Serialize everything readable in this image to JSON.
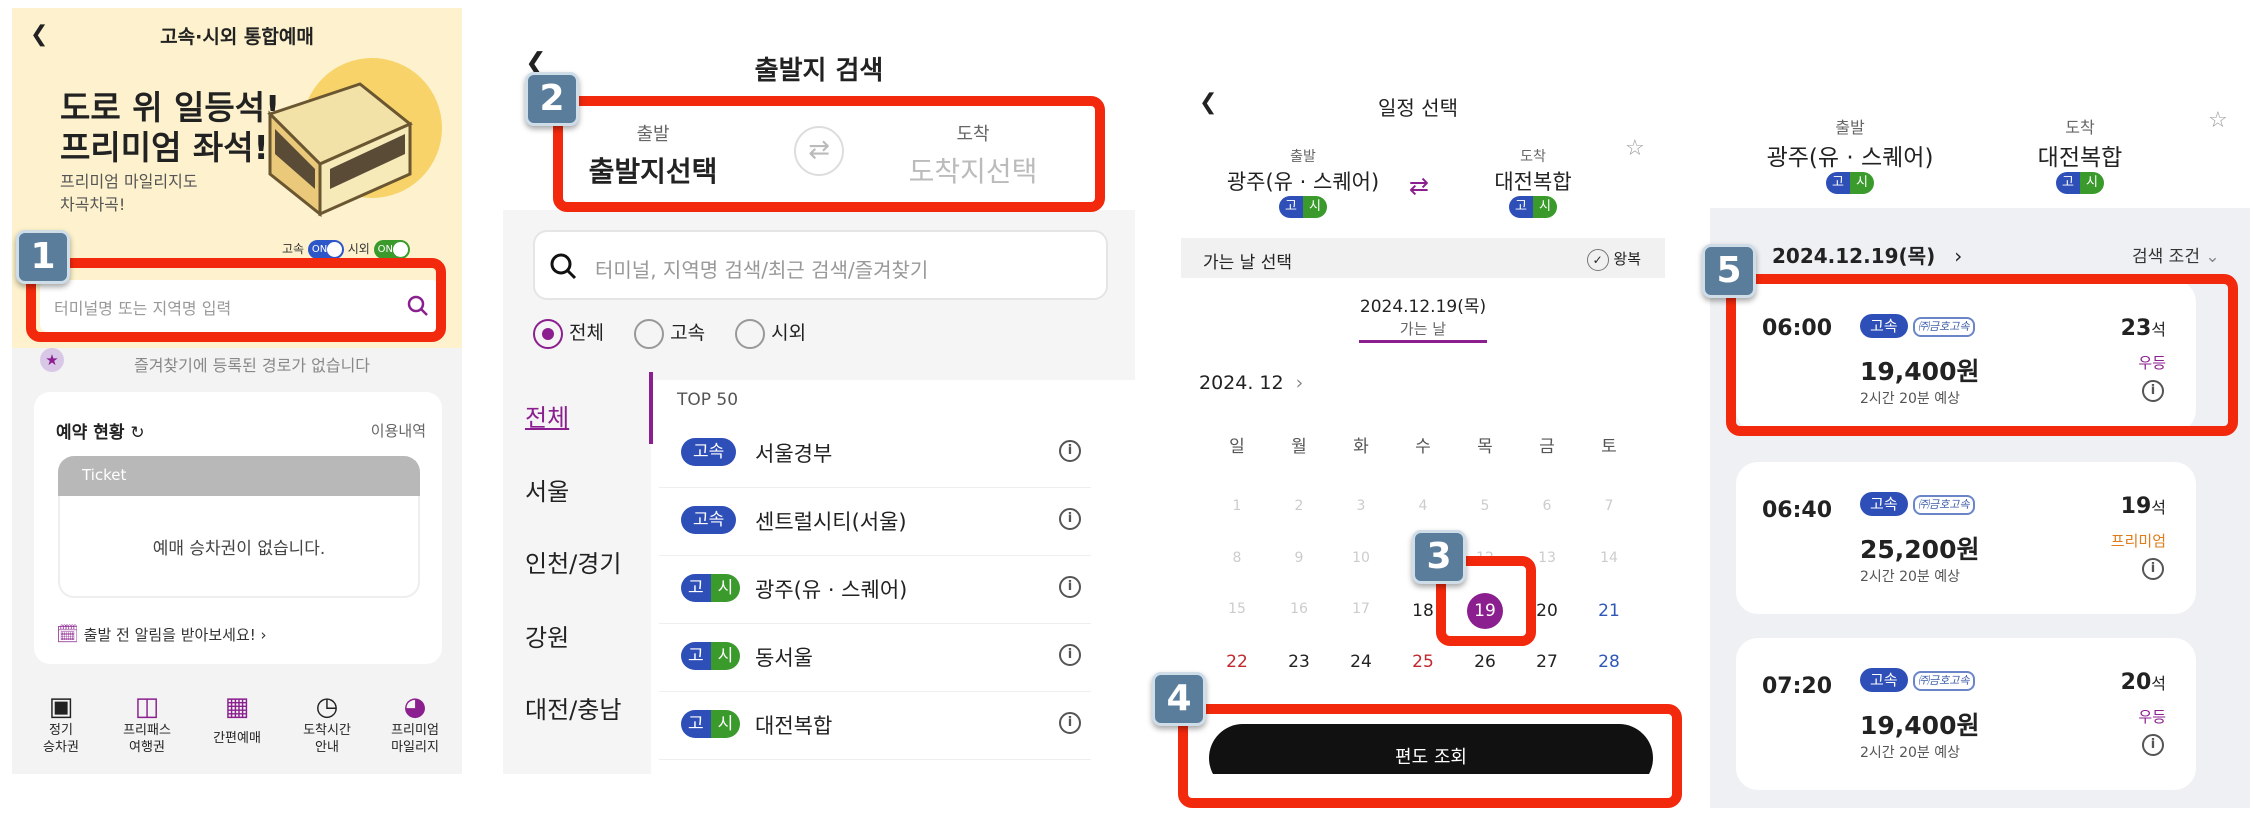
{
  "panel1": {
    "title": "고속·시외 통합예매",
    "banner_line1": "도로 위 일등석!",
    "banner_line2": "프리미엄 좌석!",
    "banner_sub1": "프리미엄 마일리지도",
    "banner_sub2": "차곡차곡!",
    "toggle_express": "고속",
    "toggle_intercity": "시외",
    "toggle_on": "ON",
    "search_placeholder": "터미널명 또는 지역명 입력",
    "favorites_empty": "즐겨찾기에 등록된 경로가 없습니다",
    "reservation_title": "예약 현황",
    "history_link": "이용내역",
    "ticket_label": "Ticket",
    "no_ticket": "예매 승차권이 없습니다.",
    "alert_link": "출발 전 알림을 받아보세요!",
    "bottom_menu": [
      {
        "l1": "정기",
        "l2": "승차권"
      },
      {
        "l1": "프리패스",
        "l2": "여행권"
      },
      {
        "l1": "간편예매",
        "l2": ""
      },
      {
        "l1": "도착시간",
        "l2": "안내"
      },
      {
        "l1": "프리미엄",
        "l2": "마일리지"
      }
    ]
  },
  "panel2": {
    "title": "출발지 검색",
    "depart_label": "출발",
    "depart_value": "출발지선택",
    "arrive_label": "도착",
    "arrive_value": "도착지선택",
    "search_placeholder": "터미널, 지역명 검색/최근 검색/즐겨찾기",
    "filters": [
      "전체",
      "고속",
      "시외"
    ],
    "regions": [
      "전체",
      "서울",
      "인천/경기",
      "강원",
      "대전/충남"
    ],
    "top_label": "TOP 50",
    "terminals": [
      {
        "type": "고속",
        "name": "서울경부"
      },
      {
        "type": "고속",
        "name": "센트럴시티(서울)"
      },
      {
        "type": "고시",
        "name": "광주(유 · 스퀘어)"
      },
      {
        "type": "고시",
        "name": "동서울"
      },
      {
        "type": "고시",
        "name": "대전복합"
      }
    ],
    "badge_express": "고속",
    "badge_g": "고",
    "badge_s": "시"
  },
  "panel3": {
    "title": "일정 선택",
    "depart_label": "출발",
    "depart_value": "광주(유 · 스퀘어)",
    "arrive_label": "도착",
    "arrive_value": "대전복합",
    "badge_g": "고",
    "badge_s": "시",
    "go_day": "가는 날 선택",
    "round_trip": "왕복",
    "date_sel": "2024.12.19(목)",
    "date_tab": "가는 날",
    "month": "2024. 12",
    "weekdays": [
      "일",
      "월",
      "화",
      "수",
      "목",
      "금",
      "토"
    ],
    "rows": [
      [
        "1",
        "2",
        "3",
        "4",
        "5",
        "6",
        "7"
      ],
      [
        "8",
        "9",
        "10",
        "11",
        "12",
        "13",
        "14"
      ],
      [
        "15",
        "16",
        "17",
        "18",
        "19",
        "20",
        "21"
      ],
      [
        "22",
        "23",
        "24",
        "25",
        "26",
        "27",
        "28"
      ]
    ],
    "search_button": "편도 조회"
  },
  "panel4": {
    "depart_label": "출발",
    "depart_value": "광주(유 · 스퀘어)",
    "arrive_label": "도착",
    "arrive_value": "대전복합",
    "badge_g": "고",
    "badge_s": "시",
    "date": "2024.12.19(목)",
    "filter": "검색 조건",
    "seat_unit": "석",
    "results": [
      {
        "time": "06:00",
        "badge": "고속",
        "price": "19,400원",
        "duration": "2시간 20분 예상",
        "seats": "23",
        "grade": "우등",
        "grade_color": "#8b1f8f"
      },
      {
        "time": "06:40",
        "badge": "고속",
        "price": "25,200원",
        "duration": "2시간 20분 예상",
        "seats": "19",
        "grade": "프리미엄",
        "grade_color": "#e07b1a"
      },
      {
        "time": "07:20",
        "badge": "고속",
        "price": "19,400원",
        "duration": "2시간 20분 예상",
        "seats": "20",
        "grade": "우등",
        "grade_color": "#8b1f8f"
      }
    ],
    "company_logo": "㈜금호고속"
  },
  "steps": [
    "1",
    "2",
    "3",
    "4",
    "5"
  ],
  "colors": {
    "accent": "#8b1f8f",
    "highlight": "#f2290d",
    "express": "#2e4fb8",
    "intercity": "#3a9a2c"
  }
}
